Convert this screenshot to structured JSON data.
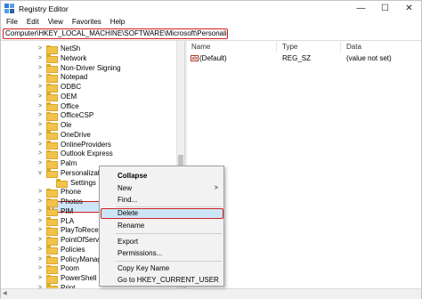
{
  "window": {
    "title": "Registry Editor",
    "minimize_glyph": "—",
    "maximize_glyph": "☐",
    "close_glyph": "✕"
  },
  "menu": [
    "File",
    "Edit",
    "View",
    "Favorites",
    "Help"
  ],
  "address": "Computer\\HKEY_LOCAL_MACHINE\\SOFTWARE\\Microsoft\\Personalization",
  "tree": {
    "items": [
      {
        "label": "NetSh",
        "chevron": ">"
      },
      {
        "label": "Network",
        "chevron": ">"
      },
      {
        "label": "Non-Driver Signing",
        "chevron": ">"
      },
      {
        "label": "Notepad",
        "chevron": ">"
      },
      {
        "label": "ODBC",
        "chevron": ">"
      },
      {
        "label": "OEM",
        "chevron": ">"
      },
      {
        "label": "Office",
        "chevron": ">"
      },
      {
        "label": "OfficeCSP",
        "chevron": ">"
      },
      {
        "label": "Ole",
        "chevron": ">"
      },
      {
        "label": "OneDrive",
        "chevron": ">"
      },
      {
        "label": "OnlineProviders",
        "chevron": ">"
      },
      {
        "label": "Outlook Express",
        "chevron": ">"
      },
      {
        "label": "Palm",
        "chevron": ">"
      },
      {
        "label": "Personalization",
        "chevron": "v"
      },
      {
        "label": "Settings",
        "chevron": ""
      },
      {
        "label": "Phone",
        "chevron": ">"
      },
      {
        "label": "Photos",
        "chevron": ">"
      },
      {
        "label": "PIM",
        "chevron": ">"
      },
      {
        "label": "PLA",
        "chevron": ">"
      },
      {
        "label": "PlayToReceiver",
        "chevron": ">"
      },
      {
        "label": "PointOfService",
        "chevron": ">"
      },
      {
        "label": "Policies",
        "chevron": ">"
      },
      {
        "label": "PolicyManager",
        "chevron": ">"
      },
      {
        "label": "Poom",
        "chevron": ">"
      },
      {
        "label": "PowerShell",
        "chevron": ">"
      },
      {
        "label": "Print",
        "chevron": ">"
      }
    ]
  },
  "list": {
    "columns": [
      "Name",
      "Type",
      "Data"
    ],
    "rows": [
      {
        "icon": "ab",
        "name": "(Default)",
        "type": "REG_SZ",
        "data": "(value not set)"
      }
    ]
  },
  "context_menu": {
    "collapse": "Collapse",
    "new": "New",
    "new_arrow": ">",
    "find": "Find...",
    "delete": "Delete",
    "rename": "Rename",
    "export": "Export",
    "permissions": "Permissions...",
    "copy_key_name": "Copy Key Name",
    "goto_hkcu": "Go to HKEY_CURRENT_USER"
  },
  "colors": {
    "highlight_border": "#d21f1f",
    "selection": "#cde6f7",
    "folder": "#f2c24a"
  }
}
